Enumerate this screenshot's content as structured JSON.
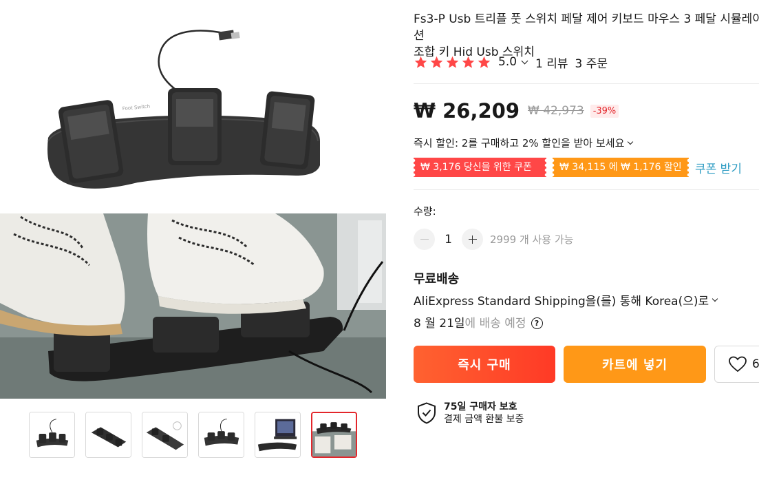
{
  "product": {
    "title": "Fs3-P Usb 트리플 풋 스위치 페달 제어 키보드 마우스 3 페달 시뮬레이션\n조합 키 Hid Usb 스위치",
    "rating": "5.0",
    "stars": 5,
    "reviews": "1 리뷰",
    "orders": "3 주문"
  },
  "price": {
    "current": "₩ 26,209",
    "original": "₩ 42,973",
    "discount": "-39%"
  },
  "promotion": {
    "text": "즉시 할인: 2를 구매하고 2% 할인을 받아 보세요"
  },
  "coupons": {
    "items": [
      "₩ 3,176 당신을 위한 쿠폰",
      "₩ 34,115 에 ₩ 1,176 할인"
    ],
    "get_label": "쿠폰 받기"
  },
  "quantity": {
    "label": "수량:",
    "value": "1",
    "available": "2999 개 사용 가능"
  },
  "shipping": {
    "title": "무료배송",
    "method": "AliExpress Standard Shipping을(를) 통해 Korea(으)로",
    "date": "8 월 21일",
    "date_suffix": "에 배송 예정"
  },
  "actions": {
    "buy": "즉시 구매",
    "cart": "카트에 넣기",
    "wishlist_count": "6"
  },
  "protection": {
    "title": "75일 구매자 보호",
    "subtitle": "결제 금액 환불 보증"
  },
  "gallery": {
    "thumbnail_count": 6,
    "active_index": 5
  },
  "colors": {
    "accent_red": "#ff4747",
    "accent_orange": "#ff9817",
    "star": "#ff4747",
    "link": "#2e9cc3"
  }
}
